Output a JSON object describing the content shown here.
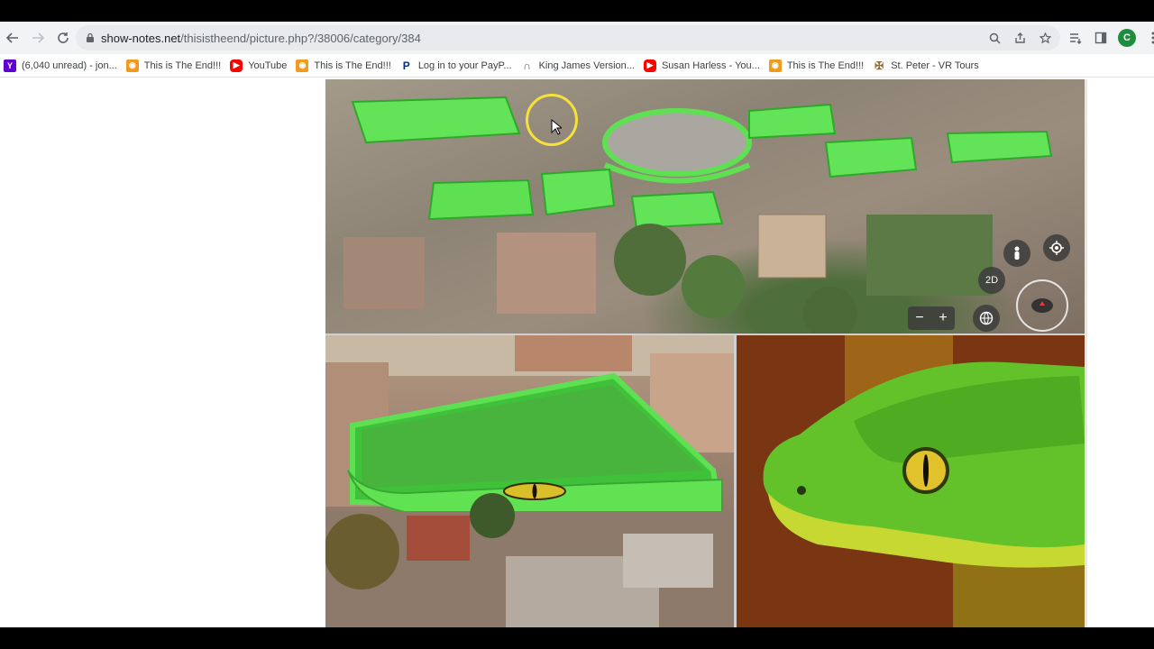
{
  "browser": {
    "url_domain": "show-notes.net",
    "url_path": "/thisistheend/picture.php?/38006/category/384",
    "avatar_letter": "C"
  },
  "bookmarks": [
    {
      "label": "(6,040 unread) - jon...",
      "icon": "yahoo-mail-icon"
    },
    {
      "label": "This is The End!!!",
      "icon": "camera-icon"
    },
    {
      "label": "YouTube",
      "icon": "youtube-icon"
    },
    {
      "label": "This is The End!!!",
      "icon": "camera-icon"
    },
    {
      "label": "Log in to your PayP...",
      "icon": "paypal-icon"
    },
    {
      "label": "King James Version...",
      "icon": "headphones-icon"
    },
    {
      "label": "Susan Harless - You...",
      "icon": "youtube-icon"
    },
    {
      "label": "This is The End!!!",
      "icon": "camera-icon"
    },
    {
      "label": "St. Peter - VR Tours",
      "icon": "church-icon"
    }
  ],
  "picture": {
    "map_controls": {
      "view_2d_label": "2D",
      "zoom_out_label": "−",
      "zoom_in_label": "+"
    }
  }
}
